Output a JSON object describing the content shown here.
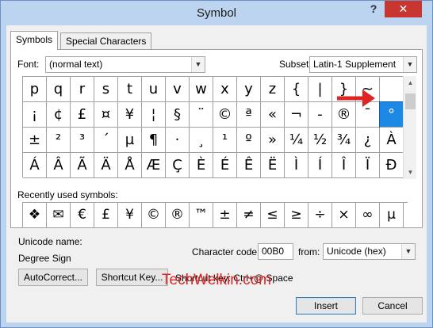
{
  "window": {
    "title": "Symbol",
    "help": "?",
    "close": "✕"
  },
  "tabs": [
    {
      "label": "Symbols"
    },
    {
      "label": "Special Characters"
    }
  ],
  "font": {
    "label": "Font:",
    "value": "(normal text)"
  },
  "subset": {
    "label": "Subset:",
    "value": "Latin-1 Supplement"
  },
  "symbol_grid": {
    "rows": [
      [
        "p",
        "q",
        "r",
        "s",
        "t",
        "u",
        "v",
        "w",
        "x",
        "y",
        "z",
        "{",
        "|",
        "}",
        "~",
        ""
      ],
      [
        "¡",
        "¢",
        "£",
        "¤",
        "¥",
        "¦",
        "§",
        "¨",
        "©",
        "ª",
        "«",
        "¬",
        "-",
        "®",
        "¯",
        "°"
      ],
      [
        "±",
        "²",
        "³",
        "´",
        "µ",
        "¶",
        "·",
        "¸",
        "¹",
        "º",
        "»",
        "¼",
        "½",
        "¾",
        "¿",
        "À"
      ],
      [
        "Á",
        "Â",
        "Ã",
        "Ä",
        "Å",
        "Æ",
        "Ç",
        "È",
        "É",
        "Ê",
        "Ë",
        "Ì",
        "Í",
        "Î",
        "Ï",
        "Ð"
      ]
    ],
    "selected": "°"
  },
  "recent": {
    "label": "Recently used symbols:",
    "symbols": [
      "❖",
      "✉",
      "€",
      "£",
      "¥",
      "©",
      "®",
      "™",
      "±",
      "≠",
      "≤",
      "≥",
      "÷",
      "×",
      "∞",
      "µ"
    ]
  },
  "unicode": {
    "name_label": "Unicode name:",
    "name_value": "Degree Sign"
  },
  "char_code": {
    "label": "Character code:",
    "value": "00B0",
    "from_label": "from:",
    "from_value": "Unicode (hex)"
  },
  "buttons": {
    "autocorrect": "AutoCorrect...",
    "shortcut_key": "Shortcut Key...",
    "insert": "Insert",
    "cancel": "Cancel"
  },
  "shortcut_text": "Shortcut key: Ctrl+@,Space",
  "watermark": "TechWelkin.com",
  "colors": {
    "selected_cell": "#1e88e5",
    "arrow": "#e02424",
    "close": "#c7372f"
  }
}
